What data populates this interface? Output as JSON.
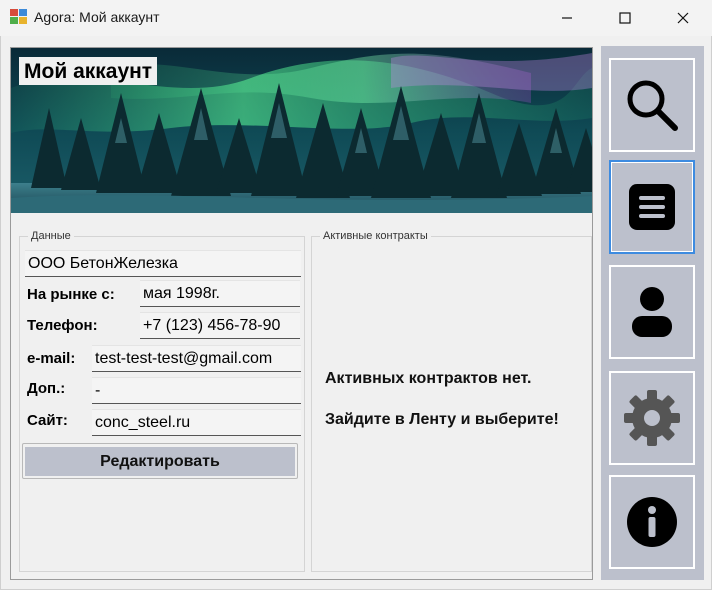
{
  "window": {
    "title": "Agora: Мой аккаунт"
  },
  "banner": {
    "title": "Мой аккаунт"
  },
  "data_group": {
    "label": "Данные",
    "company": "ООО БетонЖелезка",
    "market_since_label": "На рынке с:",
    "market_since_value": "мая 1998г.",
    "phone_label": "Телефон:",
    "phone_value": "+7 (123) 456-78-90",
    "email_label": "e-mail:",
    "email_value": "test-test-test@gmail.com",
    "extra_label": "Доп.:",
    "extra_value": "-",
    "site_label": "Сайт:",
    "site_value": "conc_steel.ru",
    "edit_button": "Редактировать"
  },
  "contracts_group": {
    "label": "Активные контракты",
    "message_line1": "Активных контрактов нет.",
    "message_line2": "Зайдите в Ленту и выберите!"
  },
  "nav": {
    "items": [
      "search-icon",
      "feed-icon",
      "account-icon",
      "settings-icon",
      "info-icon"
    ],
    "active_index": 1
  },
  "colors": {
    "nav_background": "#bcc0cc",
    "active_border": "#3d8be0",
    "window_background": "#f0f0f0"
  }
}
